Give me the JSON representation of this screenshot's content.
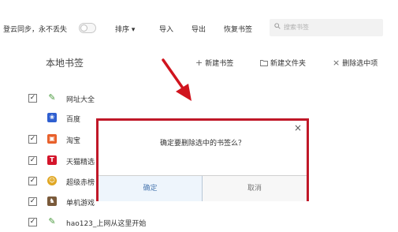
{
  "toolbar": {
    "sync_label": "登云同步，永不丢失",
    "sort_label": "排序",
    "import_label": "导入",
    "export_label": "导出",
    "restore_label": "恢复书签",
    "search_placeholder": "搜索书签",
    "sort_arrow": "▾",
    "sync_enabled": false
  },
  "section": {
    "title": "本地书签",
    "new_bookmark_label": "新建书签",
    "new_folder_label": "新建文件夹",
    "delete_selected_label": "删除选中项"
  },
  "bookmarks": [
    {
      "label": "网址大全",
      "checked": true,
      "icon": "pen-icon",
      "color": "#4a9a3e"
    },
    {
      "label": "百度",
      "checked": false,
      "icon": "paw-icon",
      "color": "#2f5fd0"
    },
    {
      "label": "淘宝",
      "checked": true,
      "icon": "taobao-icon",
      "color": "#e8602a"
    },
    {
      "label": "天猫精选",
      "checked": true,
      "icon": "tmall-icon",
      "color": "#d4152b"
    },
    {
      "label": "超级赤榜",
      "checked": true,
      "icon": "smile-icon",
      "color": "#e0a620"
    },
    {
      "label": "单机游戏",
      "checked": true,
      "icon": "game-icon",
      "color": "#7a5a3a"
    },
    {
      "label": "hao123_上网从这里开始",
      "checked": true,
      "icon": "hao123-icon",
      "color": "#4a9a3e"
    }
  ],
  "dialog": {
    "message": "确定要删除选中的书签么？",
    "confirm_label": "确定",
    "cancel_label": "取消",
    "close_glyph": "×",
    "border_color": "#c01828"
  },
  "annotation": {
    "arrow_color": "#d0141e"
  }
}
